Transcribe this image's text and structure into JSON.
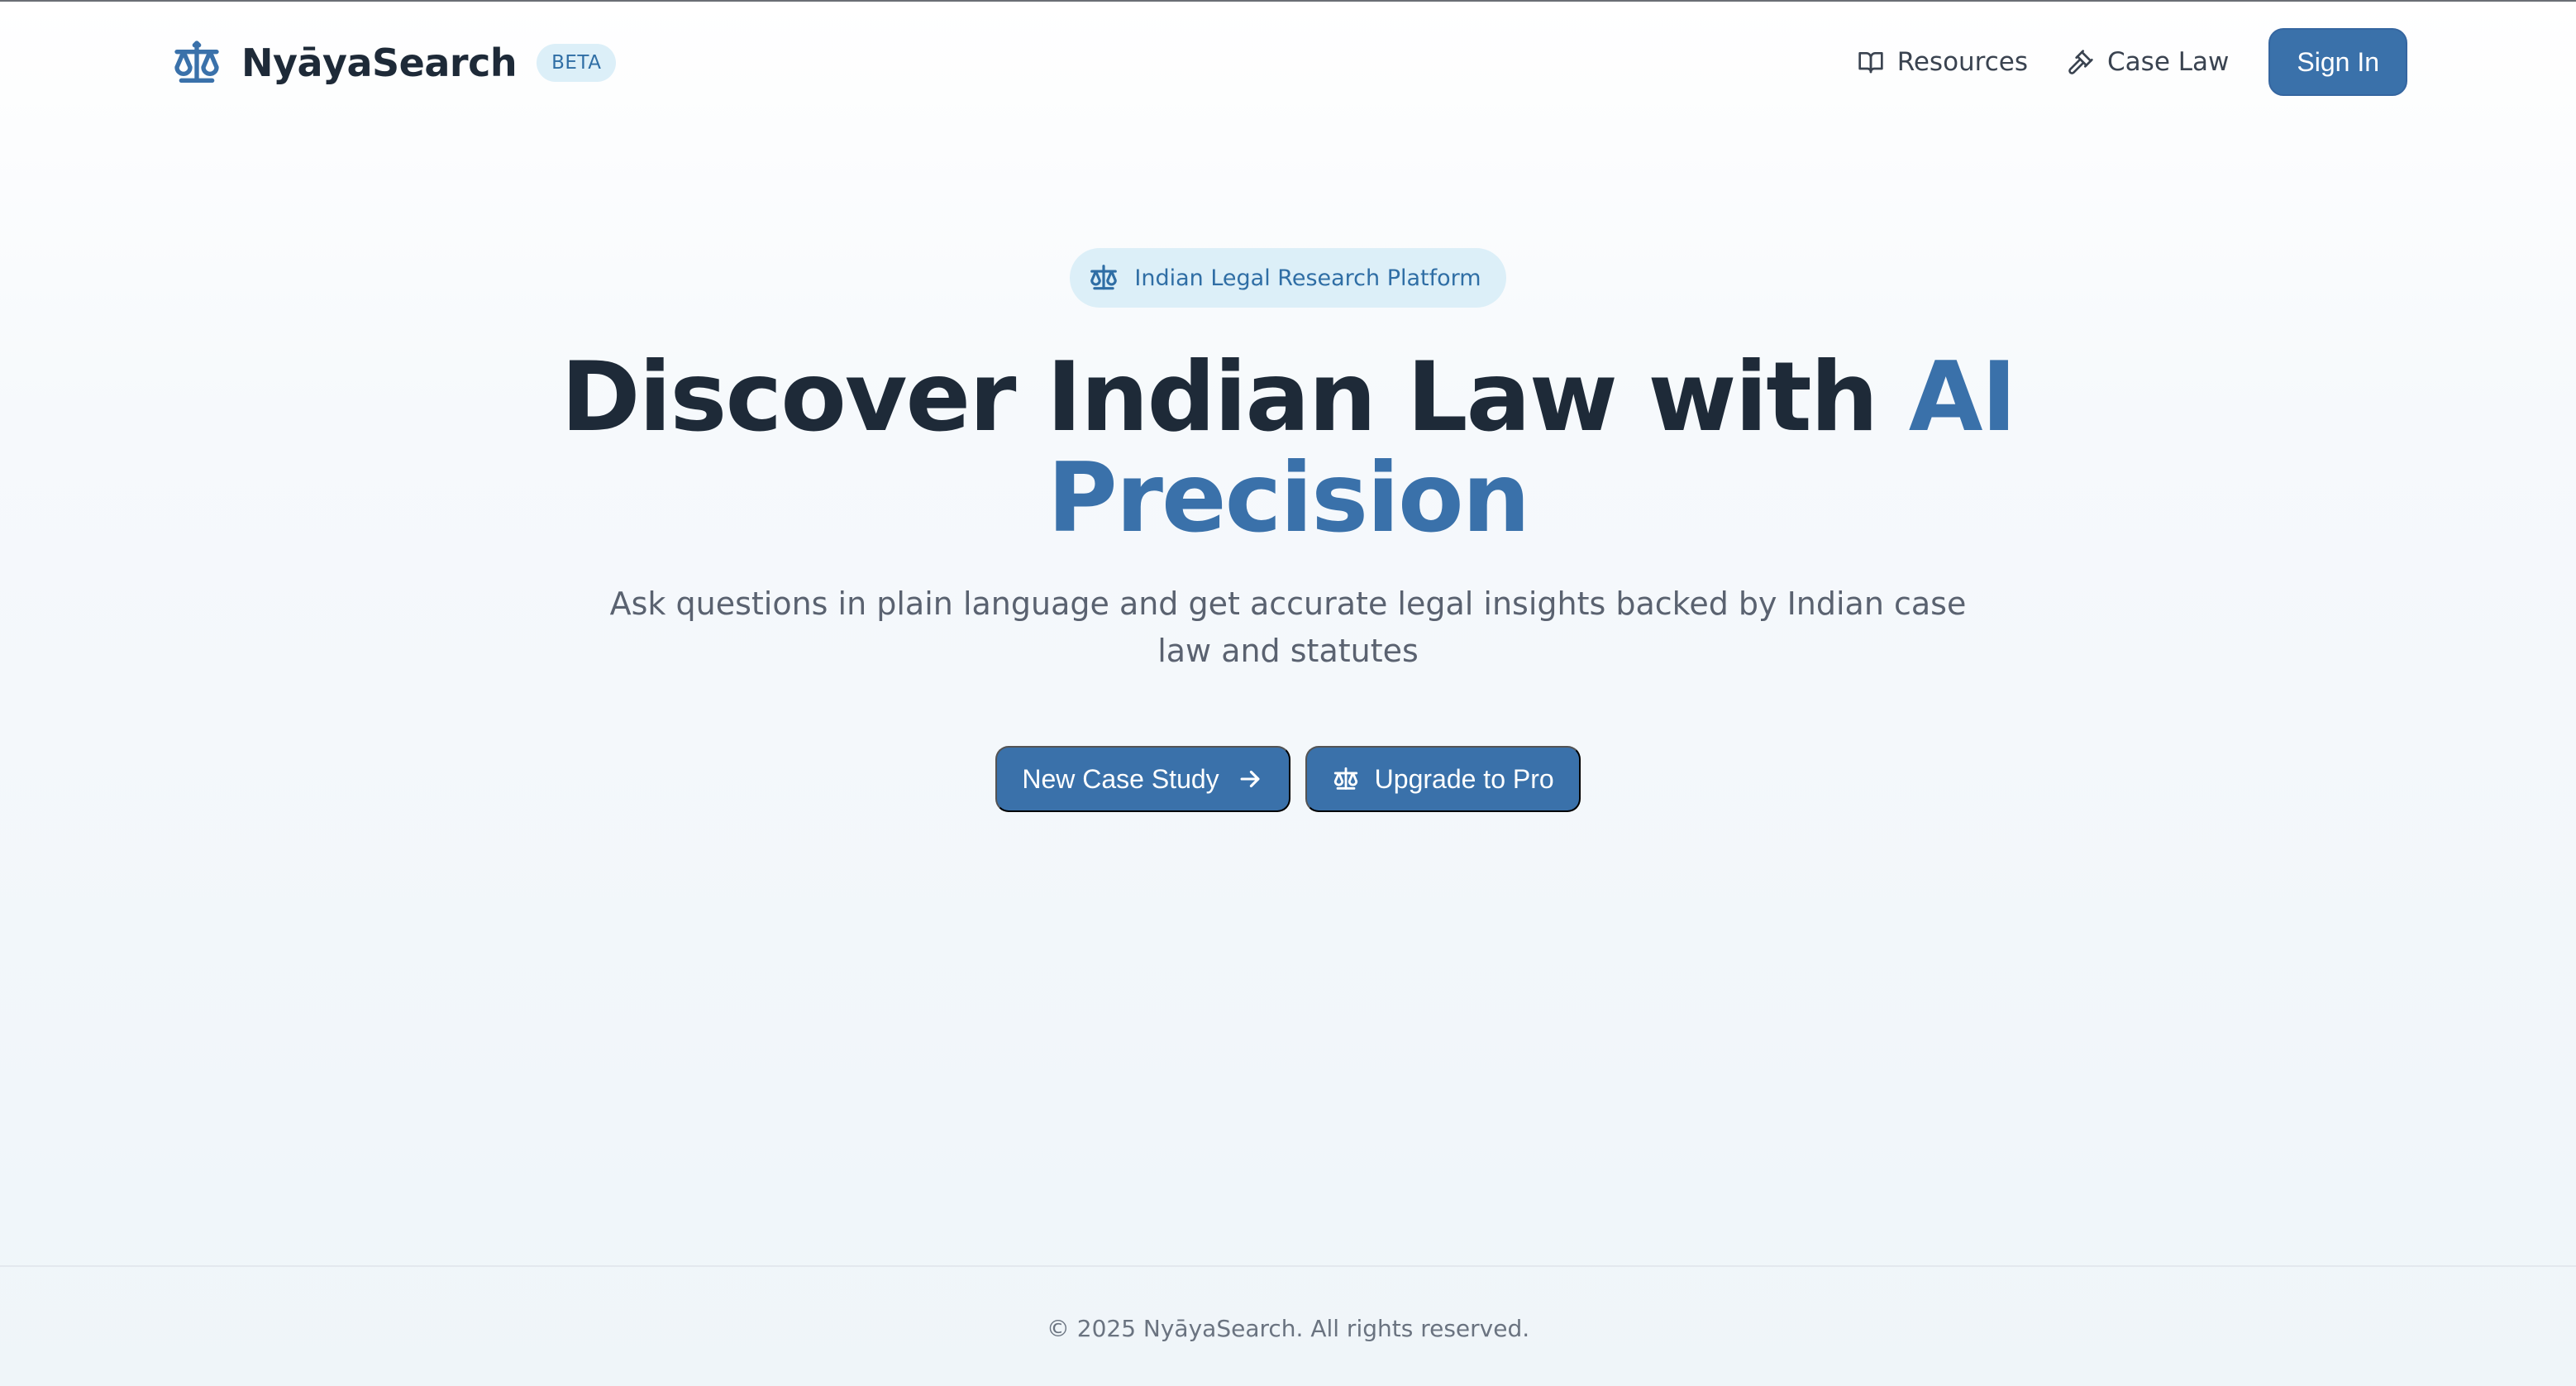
{
  "brand": {
    "name": "NyāyaSearch",
    "badge": "BETA",
    "icon": "scale-icon"
  },
  "nav": {
    "items": [
      {
        "label": "Resources",
        "icon": "book-open-icon"
      },
      {
        "label": "Case Law",
        "icon": "gavel-icon"
      }
    ],
    "signin_label": "Sign In"
  },
  "hero": {
    "pill_label": "Indian Legal Research Platform",
    "headline_main": "Discover Indian Law with ",
    "headline_accent_1": "AI",
    "headline_accent_2": "Precision",
    "subtitle": "Ask questions in plain language and get accurate legal insights backed by Indian case law and statutes",
    "primary_cta": "New Case Study",
    "secondary_cta": "Upgrade to Pro"
  },
  "footer": {
    "copyright": "© 2025 NyāyaSearch. All rights reserved."
  },
  "colors": {
    "accent": "#3a71aa",
    "badge_bg": "#dceff8",
    "text_dark": "#1e2a38"
  }
}
